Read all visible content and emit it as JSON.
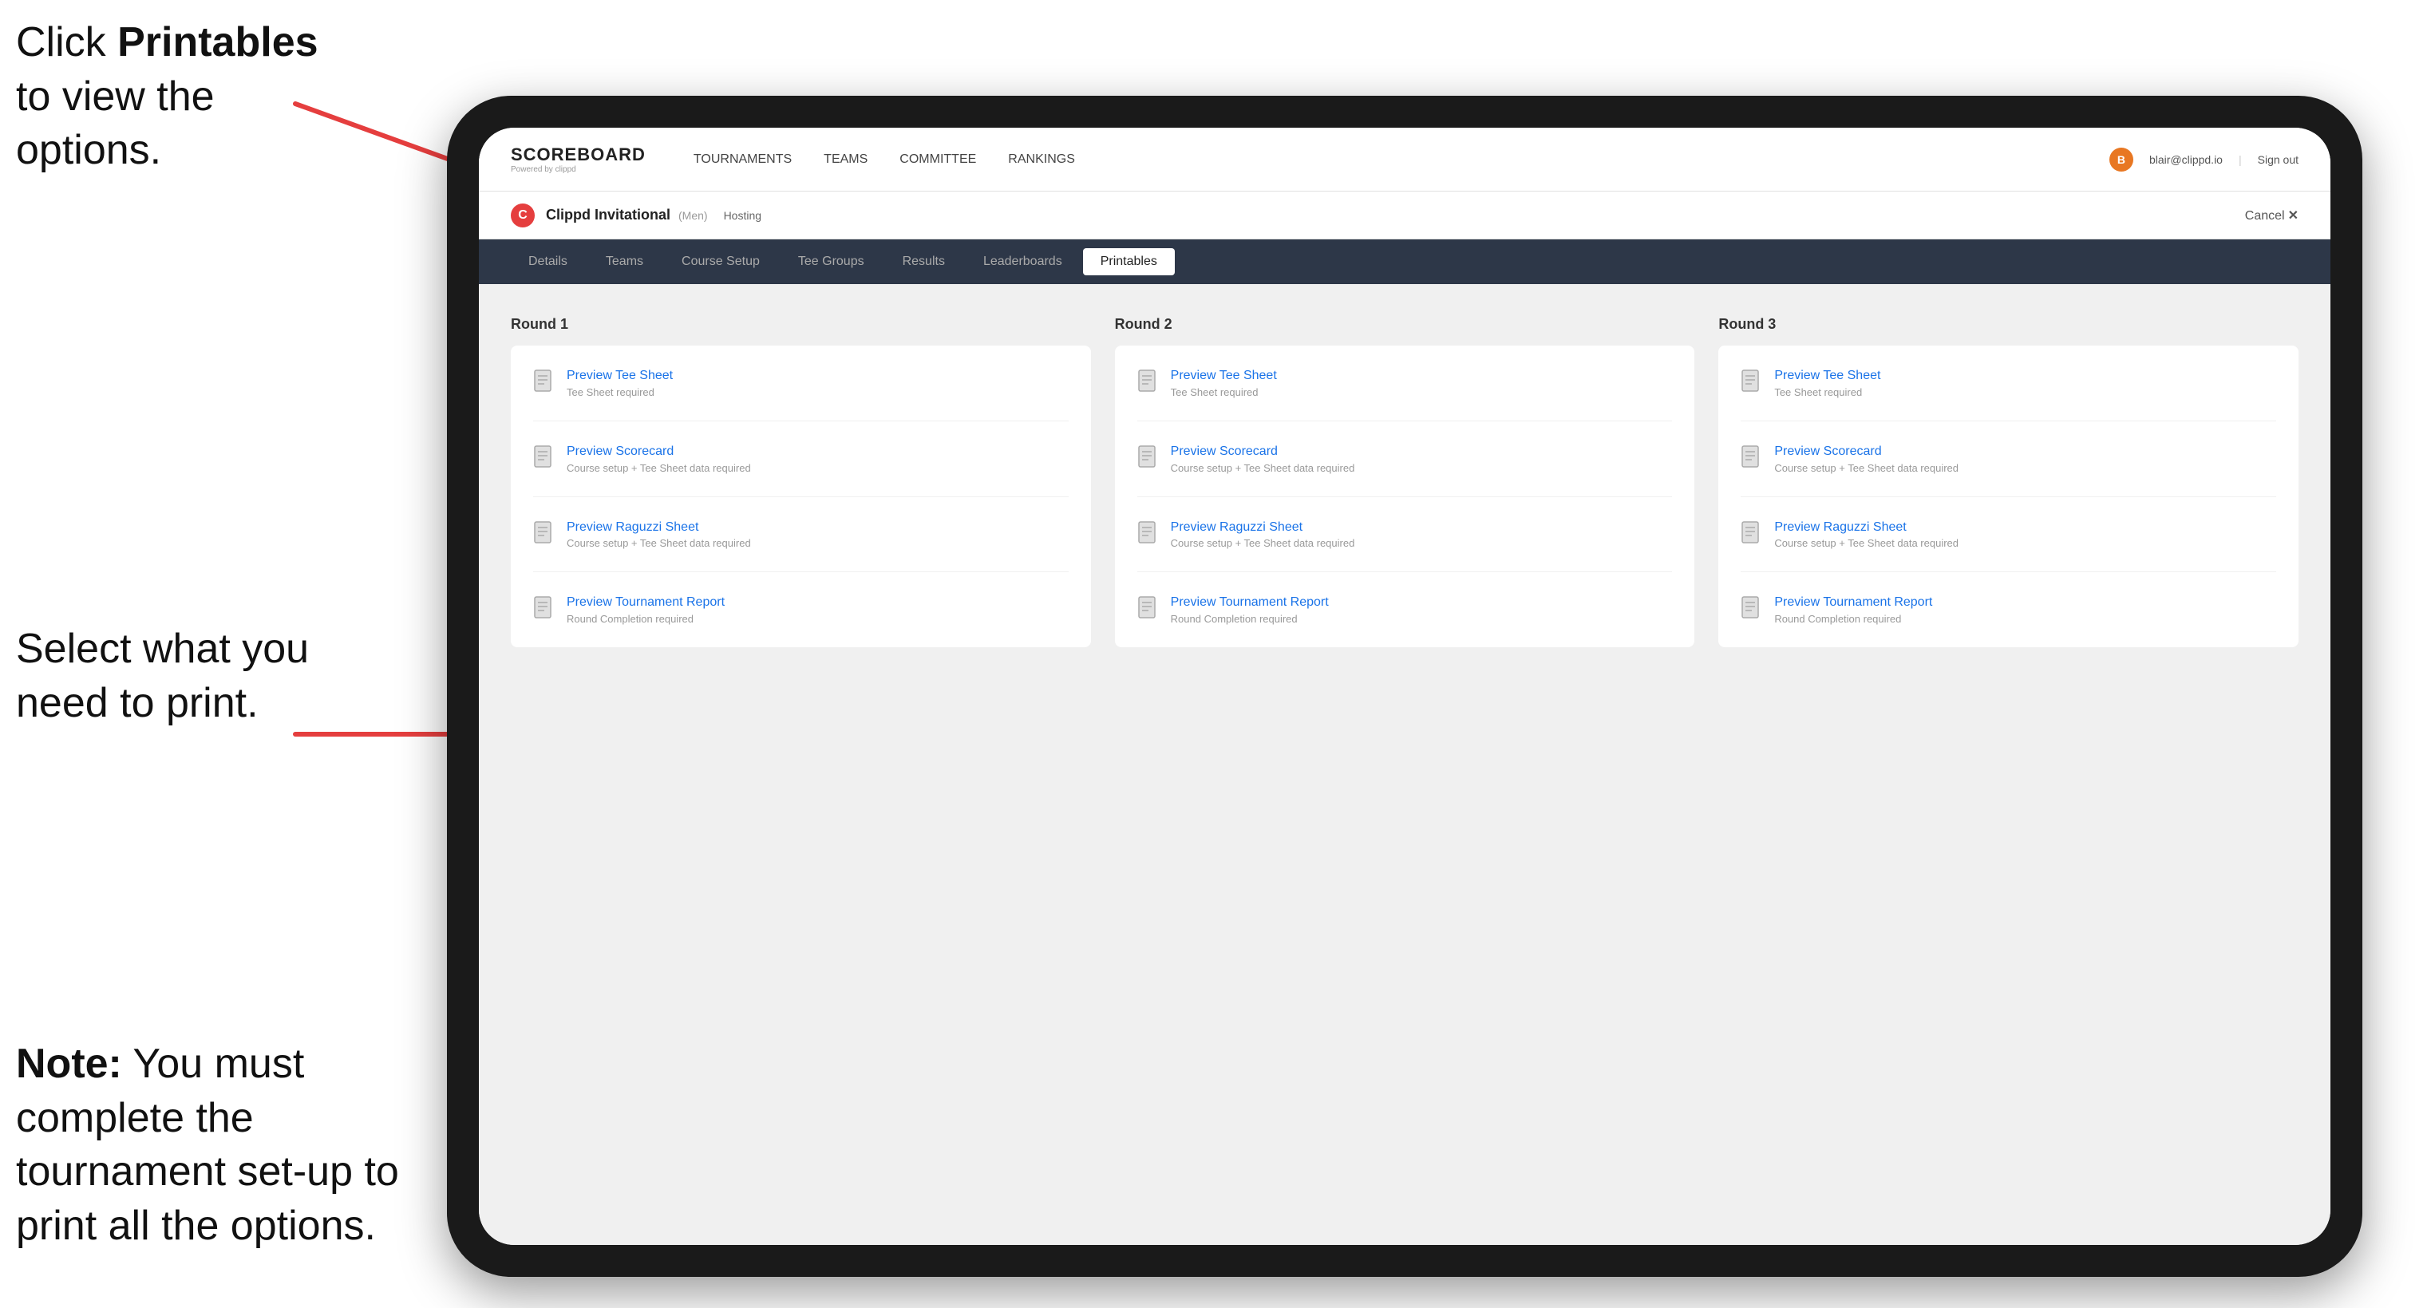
{
  "annotations": {
    "top_text_1": "Click ",
    "top_bold": "Printables",
    "top_text_2": " to view the options.",
    "middle_text": "Select what you need to print.",
    "bottom_text_note": "Note:",
    "bottom_text_rest": " You must complete the tournament set-up to print all the options."
  },
  "nav": {
    "logo_title": "SCOREBOARD",
    "logo_sub": "Powered by clippd",
    "links": [
      {
        "label": "TOURNAMENTS",
        "active": false
      },
      {
        "label": "TEAMS",
        "active": false
      },
      {
        "label": "COMMITTEE",
        "active": false
      },
      {
        "label": "RANKINGS",
        "active": false
      }
    ],
    "user_email": "blair@clippd.io",
    "sign_out": "Sign out"
  },
  "tournament": {
    "name": "Clippd Invitational",
    "type": "(Men)",
    "status": "Hosting",
    "cancel": "Cancel",
    "cancel_x": "✕"
  },
  "sub_nav": {
    "tabs": [
      {
        "label": "Details",
        "active": false
      },
      {
        "label": "Teams",
        "active": false
      },
      {
        "label": "Course Setup",
        "active": false
      },
      {
        "label": "Tee Groups",
        "active": false
      },
      {
        "label": "Results",
        "active": false
      },
      {
        "label": "Leaderboards",
        "active": false
      },
      {
        "label": "Printables",
        "active": true
      }
    ]
  },
  "rounds": [
    {
      "title": "Round 1",
      "items": [
        {
          "label": "Preview Tee Sheet",
          "sub": "Tee Sheet required"
        },
        {
          "label": "Preview Scorecard",
          "sub": "Course setup + Tee Sheet data required"
        },
        {
          "label": "Preview Raguzzi Sheet",
          "sub": "Course setup + Tee Sheet data required"
        },
        {
          "label": "Preview Tournament Report",
          "sub": "Round Completion required"
        }
      ]
    },
    {
      "title": "Round 2",
      "items": [
        {
          "label": "Preview Tee Sheet",
          "sub": "Tee Sheet required"
        },
        {
          "label": "Preview Scorecard",
          "sub": "Course setup + Tee Sheet data required"
        },
        {
          "label": "Preview Raguzzi Sheet",
          "sub": "Course setup + Tee Sheet data required"
        },
        {
          "label": "Preview Tournament Report",
          "sub": "Round Completion required"
        }
      ]
    },
    {
      "title": "Round 3",
      "items": [
        {
          "label": "Preview Tee Sheet",
          "sub": "Tee Sheet required"
        },
        {
          "label": "Preview Scorecard",
          "sub": "Course setup + Tee Sheet data required"
        },
        {
          "label": "Preview Raguzzi Sheet",
          "sub": "Course setup + Tee Sheet data required"
        },
        {
          "label": "Preview Tournament Report",
          "sub": "Round Completion required"
        }
      ]
    }
  ]
}
